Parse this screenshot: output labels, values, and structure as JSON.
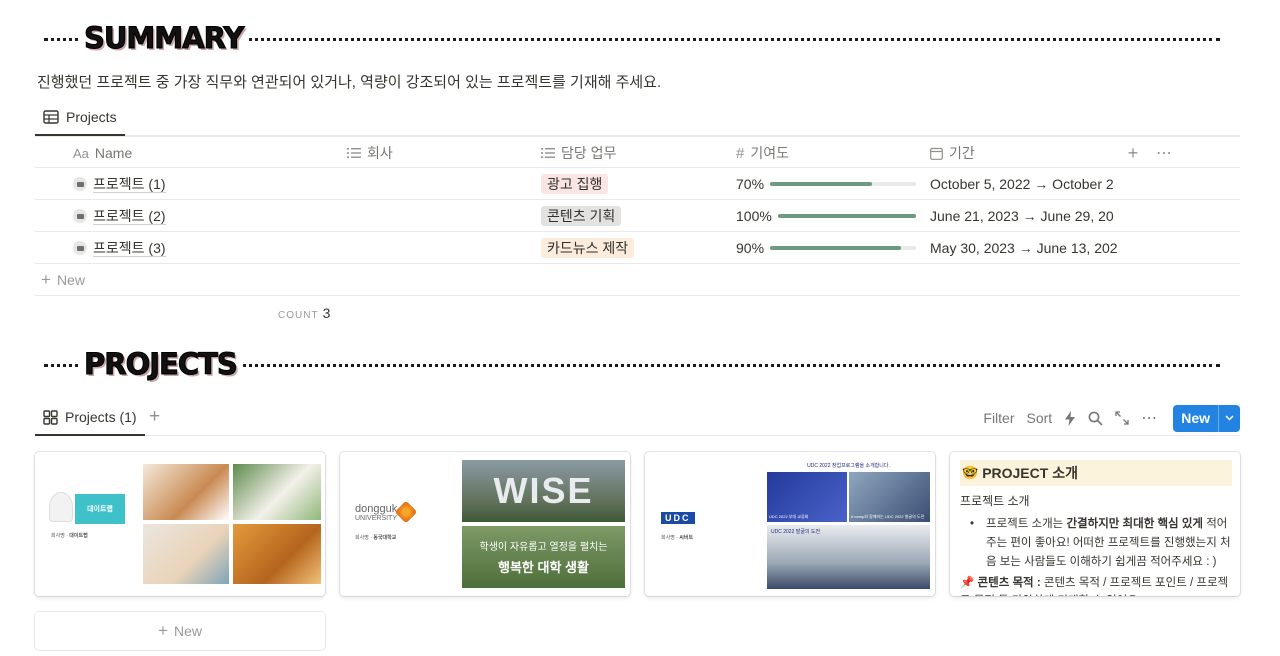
{
  "summary": {
    "heading": "SUMMARY",
    "description": "진행했던 프로젝트 중 가장 직무와 연관되어 있거나, 역량이 강조되어 있는 프로젝트를 기재해 주세요."
  },
  "table_view": {
    "tab_label": "Projects"
  },
  "table": {
    "columns": {
      "name": "Name",
      "company": "회사",
      "task": "담당 업무",
      "contribution": "기여도",
      "period": "기간"
    },
    "rows": [
      {
        "name": "프로젝트 (1)",
        "task": "광고 집행",
        "task_color": "#fbe4e4",
        "contribution_label": "70%",
        "contribution": 0.7,
        "period": "October 5, 2022 → October 2"
      },
      {
        "name": "프로젝트 (2)",
        "task": "콘텐츠 기획",
        "task_color": "#e3e2e0",
        "contribution_label": "100%",
        "contribution": 1.0,
        "period": "June 21, 2023 → June 29, 20"
      },
      {
        "name": "프로젝트 (3)",
        "task": "카드뉴스 제작",
        "task_color": "#fbecdd",
        "contribution_label": "90%",
        "contribution": 0.9,
        "period": "May 30, 2023 → June 13, 202"
      }
    ],
    "new_label": "New",
    "count_label": "COUNT",
    "count_value": "3"
  },
  "projects": {
    "heading": "PROJECTS",
    "tab_label": "Projects (1)",
    "toolbar": {
      "filter": "Filter",
      "sort": "Sort",
      "new_label": "New"
    },
    "cards": [
      {
        "mini_title": "대이트랩",
        "mini_sub": "회사명",
        "mini_company": "대이트랩"
      },
      {
        "logo": "dongguk",
        "logo_sub": "UNIVERSITY",
        "mini_sub": "회사명",
        "mini_company": "동국대학교",
        "photo_top_text": "WISE",
        "photo_bottom_line1": "학생이 자유롭고 열정을 펼치는",
        "photo_bottom_line2": "행복한 대학 생활"
      },
      {
        "logo": "UDC",
        "mini_sub": "회사명",
        "mini_company": "씨버트",
        "photo_top_text": "UDC 2022 창업프로그램을 소개합니다.",
        "photo_mid_left": "UDC 2022 부대 교류회",
        "photo_mid_right": "d·camp와 함께하는 UDC 2022 발굴의 도전",
        "photo_bottom_text": "UDC 2022 발굴의 도전"
      },
      {
        "title": "PROJECT 소개",
        "subtitle": "프로젝트 소개",
        "bullet_parts": [
          "프로젝트 소개는 ",
          "간결하지만 최대한 핵심 있게",
          " 적어주는 편이 좋아요! 어떠한 프로젝트를 진행했는지 처음 보는 사람들도 이해하기 쉽게끔 적어주세요 : )"
        ],
        "purpose_label": "콘텐츠 목적 :",
        "purpose_text": "콘텐츠 목적 / 프로젝트 포인트 / 프로젝트 목적 등 다양하게 기재할 수 있어요"
      }
    ],
    "new_card_label": "New"
  }
}
